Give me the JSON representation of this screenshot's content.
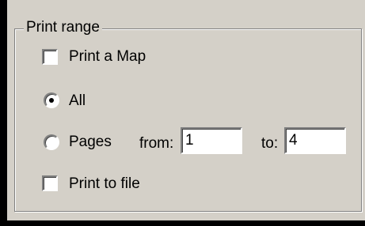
{
  "group": {
    "title": "Print range"
  },
  "print_map": {
    "label": "Print a Map",
    "checked": false
  },
  "range_all": {
    "label": "All",
    "selected": true
  },
  "range_pages": {
    "label": "Pages",
    "selected": false
  },
  "from": {
    "label": "from:",
    "value": "1"
  },
  "to": {
    "label": "to:",
    "value": "4"
  },
  "print_to_file": {
    "label": "Print to file",
    "checked": false
  }
}
